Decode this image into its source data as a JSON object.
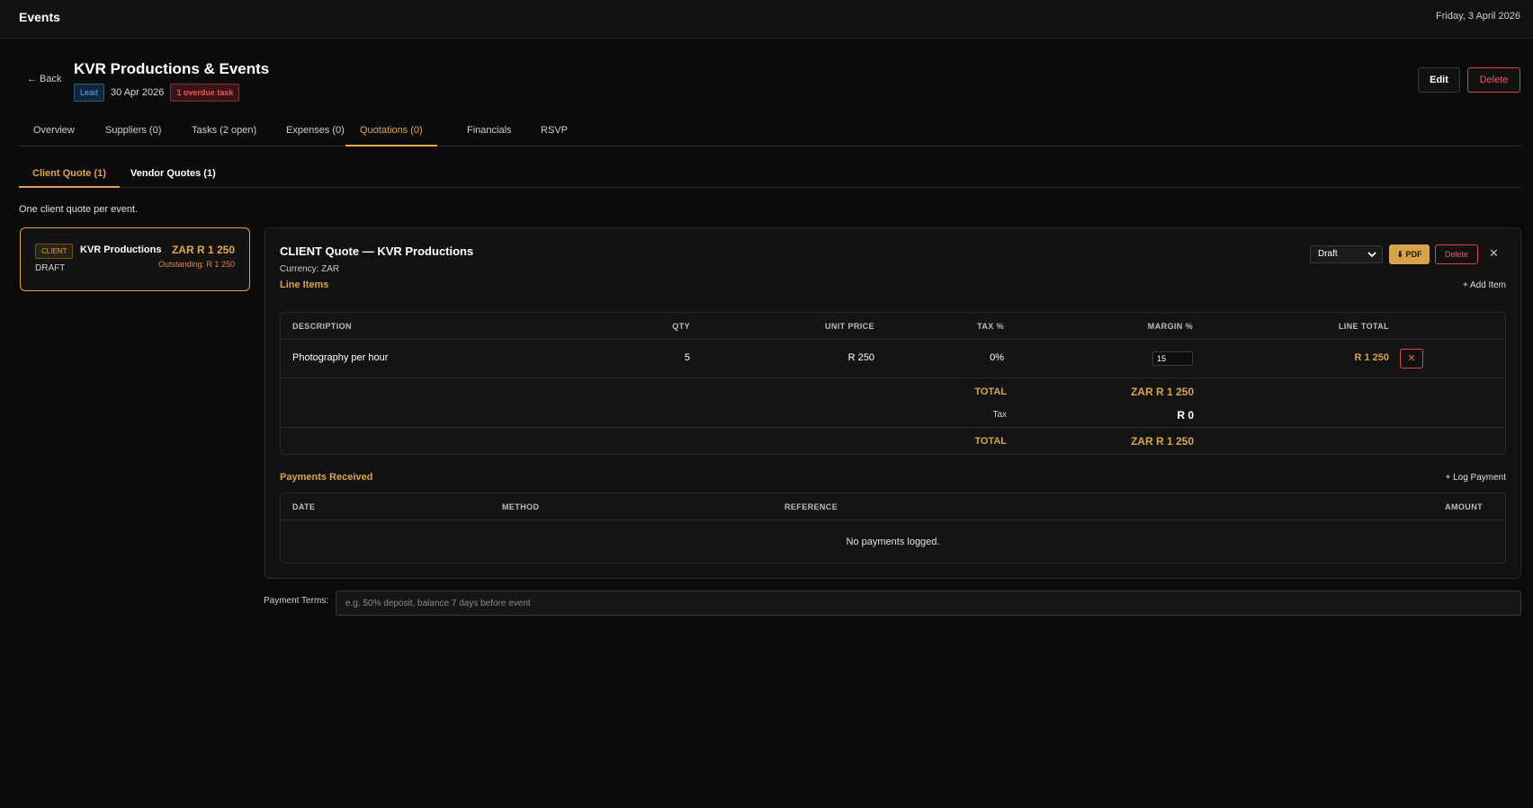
{
  "app": {
    "title": "Events",
    "date": "Friday, 3 April 2026"
  },
  "event": {
    "back_label": "← Back",
    "title": "KVR Productions & Events",
    "stage_badge": "Lead",
    "date": "30 Apr 2026",
    "overdue_badge": "1 overdue task",
    "edit_label": "Edit",
    "delete_label": "Delete"
  },
  "tabs": [
    {
      "label": "Overview"
    },
    {
      "label": "Suppliers (0)"
    },
    {
      "label": "Tasks (2 open)"
    },
    {
      "label": "Expenses (0)"
    },
    {
      "label": "Quotations (0)"
    },
    {
      "label": "Financials"
    },
    {
      "label": "RSVP"
    }
  ],
  "subtabs": [
    {
      "label": "Client Quote (1)"
    },
    {
      "label": "Vendor Quotes (1)"
    }
  ],
  "note": "One client quote per event.",
  "quote_card": {
    "badge": "CLIENT",
    "name": "KVR Productions",
    "status": "DRAFT",
    "amount": "ZAR R 1 250",
    "outstanding": "Outstanding: R 1 250"
  },
  "quote": {
    "title": "CLIENT Quote — KVR Productions",
    "currency": "Currency: ZAR",
    "status_select": "Draft",
    "pdf_label": "⬇ PDF",
    "delete_label": "Delete",
    "close_glyph": "✕",
    "line_items_label": "Line Items",
    "add_item_label": "+ Add Item",
    "columns": {
      "description": "DESCRIPTION",
      "qty": "QTY",
      "unit_price": "UNIT PRICE",
      "tax": "TAX %",
      "margin": "MARGIN %",
      "line_total": "LINE TOTAL"
    },
    "items": [
      {
        "description": "Photography per hour",
        "qty": "5",
        "unit_price": "R 250",
        "tax": "0%",
        "margin": "15",
        "line_total": "R 1 250",
        "remove_glyph": "✕"
      }
    ],
    "subtotal_label": "TOTAL",
    "subtotal_value": "ZAR R 1 250",
    "tax_label": "Tax",
    "tax_value": "R 0",
    "total_label": "TOTAL",
    "total_value": "ZAR R 1 250",
    "payments_label": "Payments Received",
    "log_payment_label": "+ Log Payment",
    "payment_columns": {
      "date": "DATE",
      "method": "METHOD",
      "reference": "REFERENCE",
      "amount": "AMOUNT"
    },
    "payments_empty": "No payments logged."
  },
  "payment_terms": {
    "label": "Payment Terms:",
    "placeholder": "e.g. 50% deposit, balance 7 days before event",
    "value": ""
  }
}
